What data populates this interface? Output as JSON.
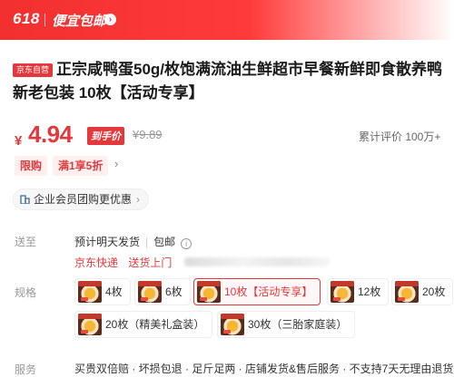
{
  "promo": {
    "event": "618",
    "label": "便宜包邮",
    "arrow": "›"
  },
  "product": {
    "store_tag": "京东自营",
    "title": "正宗咸鸭蛋50g/枚饱满流油生鲜超市早餐新鲜即食散养鸭新老包装 10枚【活动专享】"
  },
  "price": {
    "symbol": "¥",
    "current": "4.94",
    "tag": "到手价",
    "original": "¥9.89",
    "reviews": "累计评价 100万+"
  },
  "promotions": {
    "chips": [
      "限购",
      "满1享5折"
    ],
    "chevron": "›"
  },
  "enterprise": {
    "label": "企业会员团购更优惠",
    "chevron": "›"
  },
  "delivery": {
    "label": "送至",
    "shipping": "预计明天发货",
    "free_shipping": "包邮",
    "info_icon": "i",
    "courier": "京东快递",
    "pickup": "送货上门"
  },
  "specs": {
    "label": "规格",
    "options": [
      "4枚",
      "6枚",
      "10枚【活动专享】",
      "12枚",
      "20枚",
      "20枚（精美礼盒装）",
      "30枚（三胎家庭装）"
    ],
    "selected": "10枚【活动专享】"
  },
  "service": {
    "label": "服务",
    "text": "买贵双倍赔 · 坏损包退 · 足斤足两 · 店铺发货&售后服务 · 不支持7天无理由退货"
  },
  "colors": {
    "accent": "#e4393c",
    "banner": "#f23030"
  }
}
